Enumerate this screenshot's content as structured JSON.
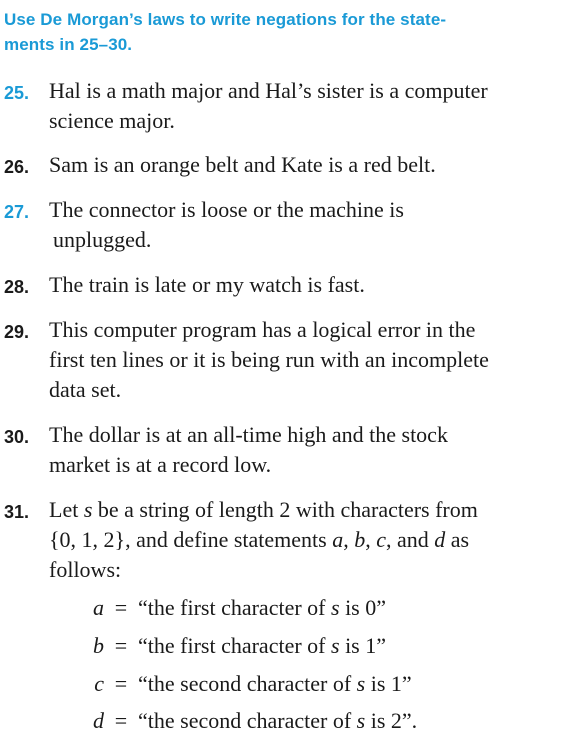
{
  "colors": {
    "accent": "#1a9ad6",
    "text": "#1a1a1a"
  },
  "instruction": "Use De Morgan’s laws to write negations for the statements in 25–30.",
  "instruction_lines": [
    "Use De Morgan’s laws to write negations for the state-",
    "ments in 25–30."
  ],
  "exercises": [
    {
      "number": "25.",
      "color": "accent",
      "lines": [
        "Hal is a math major and Hal’s sister is a computer",
        "science major."
      ]
    },
    {
      "number": "26.",
      "color": "text",
      "lines": [
        "Sam is an orange belt and Kate is a red belt."
      ]
    },
    {
      "number": "27.",
      "color": "accent",
      "lines": [
        "The connector is loose or the machine is",
        "unplugged."
      ]
    },
    {
      "number": "28.",
      "color": "text",
      "lines": [
        "The train is late or my watch is fast."
      ]
    },
    {
      "number": "29.",
      "color": "text",
      "lines": [
        "This computer program has a logical error in the",
        "first ten lines or it is being run with an incomplete",
        "data set."
      ]
    },
    {
      "number": "30.",
      "color": "text",
      "lines": [
        "The dollar is at an all-time high and the stock",
        "market is at a record low."
      ]
    },
    {
      "number": "31.",
      "color": "text",
      "lines": [
        "Let s be a string of length 2 with characters from",
        "{0, 1, 2}, and define statements a, b, c, and d as",
        "follows:"
      ]
    }
  ],
  "definitions": [
    {
      "var": "a",
      "equals": "=",
      "text_before": "“the first character of ",
      "s": "s",
      "text_after": " is 0”"
    },
    {
      "var": "b",
      "equals": "=",
      "text_before": "“the first character of ",
      "s": "s",
      "text_after": " is 1”"
    },
    {
      "var": "c",
      "equals": "=",
      "text_before": "“the second character of ",
      "s": "s",
      "text_after": " is 1”"
    },
    {
      "var": "d",
      "equals": "=",
      "text_before": "“the second character of ",
      "s": "s",
      "text_after": " is 2”."
    }
  ]
}
